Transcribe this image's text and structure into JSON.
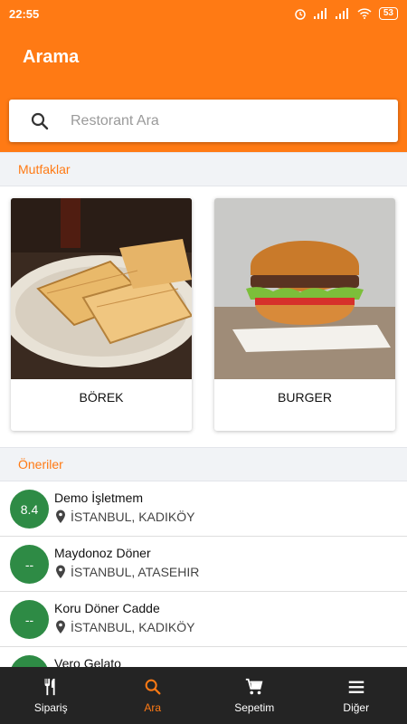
{
  "statusbar": {
    "time": "22:55",
    "battery": "53"
  },
  "header": {
    "title": "Arama"
  },
  "search": {
    "placeholder": "Restorant Ara",
    "value": ""
  },
  "cuisines": {
    "title": "Mutfaklar",
    "items": [
      {
        "label": "BÖREK"
      },
      {
        "label": "BURGER"
      }
    ]
  },
  "suggestions": {
    "title": "Öneriler",
    "items": [
      {
        "score": "8.4",
        "name": "Demo İşletmem",
        "location": "İSTANBUL, KADIKÖY"
      },
      {
        "score": "--",
        "name": "Maydonoz Döner",
        "location": "İSTANBUL, ATASEHIR"
      },
      {
        "score": "--",
        "name": "Koru Döner Cadde",
        "location": "İSTANBUL, KADIKÖY"
      },
      {
        "score": "--",
        "name": "Vero Gelato",
        "location": ""
      }
    ]
  },
  "bottom_nav": {
    "items": [
      {
        "label": "Sipariş",
        "icon": "utensils-icon"
      },
      {
        "label": "Ara",
        "icon": "search-icon"
      },
      {
        "label": "Sepetim",
        "icon": "cart-icon"
      },
      {
        "label": "Diğer",
        "icon": "menu-icon"
      }
    ],
    "active": "Ara"
  },
  "colors": {
    "primary": "#ff7a14",
    "rating": "#2e8b45",
    "nav_bg": "#242424",
    "section_bg": "#f1f3f6"
  }
}
